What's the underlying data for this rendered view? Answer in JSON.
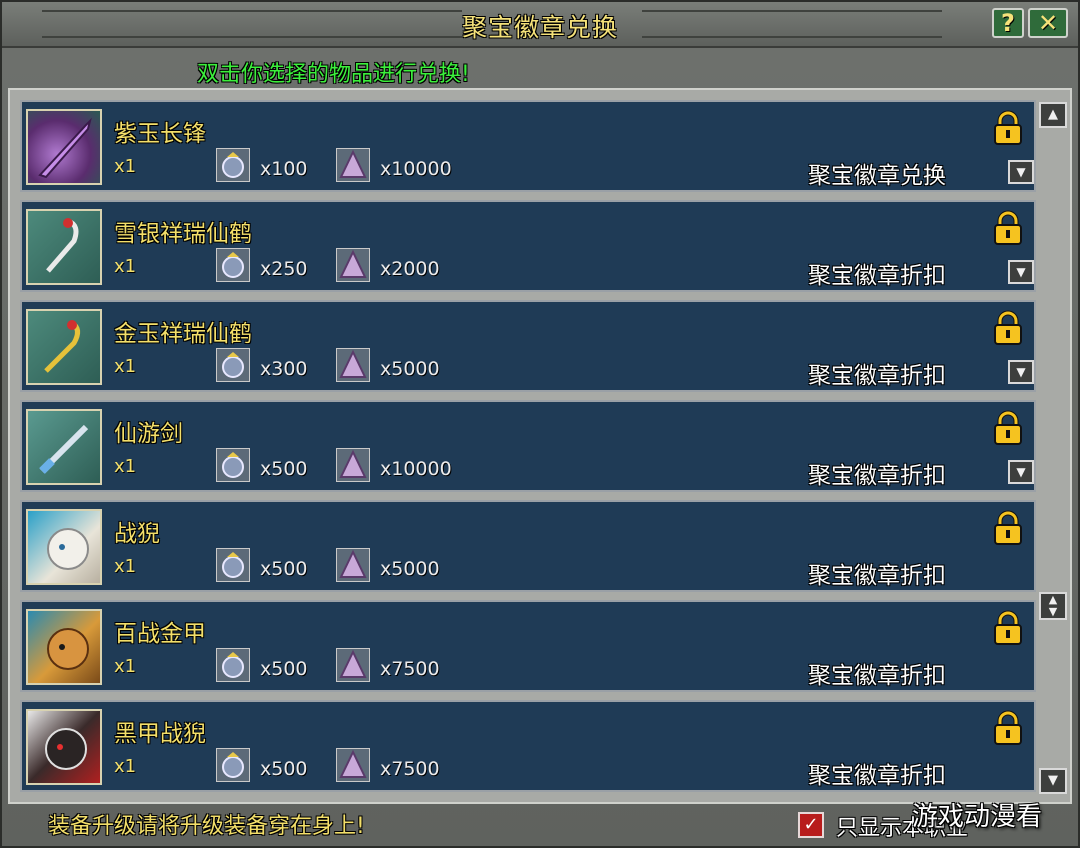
{
  "window": {
    "title": "聚宝徽章兑换",
    "help_label": "?",
    "close_label": "✕",
    "instruction": "双击你选择的物品进行兑换!"
  },
  "items": [
    {
      "name": "紫玉长锋",
      "qty": "x1",
      "badge_cost": "x100",
      "gem_cost": "x10000",
      "exchange": "聚宝徽章兑换",
      "icon": "purple-spear-icon",
      "icon_color": "#6a3c8a"
    },
    {
      "name": "雪银祥瑞仙鹤",
      "qty": "x1",
      "badge_cost": "x250",
      "gem_cost": "x2000",
      "exchange": "聚宝徽章折扣",
      "icon": "silver-crane-icon",
      "icon_color": "#3e7a6e"
    },
    {
      "name": "金玉祥瑞仙鹤",
      "qty": "x1",
      "badge_cost": "x300",
      "gem_cost": "x5000",
      "exchange": "聚宝徽章折扣",
      "icon": "gold-crane-icon",
      "icon_color": "#3d7a6a"
    },
    {
      "name": "仙游剑",
      "qty": "x1",
      "badge_cost": "x500",
      "gem_cost": "x10000",
      "exchange": "聚宝徽章折扣",
      "icon": "sword-icon",
      "icon_color": "#3e7f77"
    },
    {
      "name": "战猊",
      "qty": "x1",
      "badge_cost": "x500",
      "gem_cost": "x5000",
      "exchange": "聚宝徽章折扣",
      "icon": "white-beast-icon",
      "icon_color": "#d9d4c4"
    },
    {
      "name": "百战金甲",
      "qty": "x1",
      "badge_cost": "x500",
      "gem_cost": "x7500",
      "exchange": "聚宝徽章折扣",
      "icon": "golden-beast-icon",
      "icon_color": "#b87a2a"
    },
    {
      "name": "黑甲战猊",
      "qty": "x1",
      "badge_cost": "x500",
      "gem_cost": "x7500",
      "exchange": "聚宝徽章折扣",
      "icon": "black-beast-icon",
      "icon_color": "#3a3030"
    }
  ],
  "footer": {
    "notice": "装备升级请将升级装备穿在身上!",
    "checkbox_label": "只显示本职业",
    "checkbox_checked": true
  },
  "watermark": "游戏动漫看"
}
